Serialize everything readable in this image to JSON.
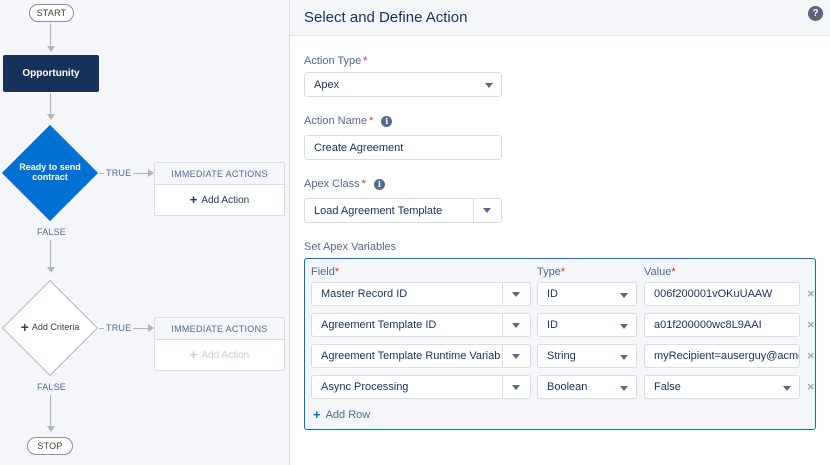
{
  "flow": {
    "start_label": "START",
    "stop_label": "STOP",
    "object_node_label": "Opportunity",
    "criteria1_label": "Ready to send contract",
    "criteria2_label": "Add Criteria",
    "true_label": "TRUE",
    "false_label": "FALSE",
    "immediate_actions_label": "IMMEDIATE ACTIONS",
    "add_action_label": "Add Action"
  },
  "panel": {
    "title": "Select and Define Action",
    "help_icon": "?",
    "action_type": {
      "label": "Action Type",
      "required": "*",
      "value": "Apex"
    },
    "action_name": {
      "label": "Action Name",
      "required": "*",
      "value": "Create Agreement"
    },
    "apex_class": {
      "label": "Apex Class",
      "required": "*",
      "value": "Load Agreement Template"
    },
    "apex_vars": {
      "label": "Set Apex Variables",
      "columns": [
        {
          "label": "Field",
          "required": "*"
        },
        {
          "label": "Type",
          "required": "*"
        },
        {
          "label": "Value",
          "required": "*"
        }
      ],
      "rows": [
        {
          "field": "Master Record ID",
          "type": "ID",
          "value": "006f200001vOKuUAAW"
        },
        {
          "field": "Agreement Template ID",
          "type": "ID",
          "value": "a01f200000wc8L9AAI"
        },
        {
          "field": "Agreement Template Runtime Variables",
          "type": "String",
          "value": "myRecipient=auserguy@acme.com"
        },
        {
          "field": "Async Processing",
          "type": "Boolean",
          "value": "False"
        }
      ],
      "remove_icon": "×",
      "add_row_label": "Add Row"
    }
  }
}
